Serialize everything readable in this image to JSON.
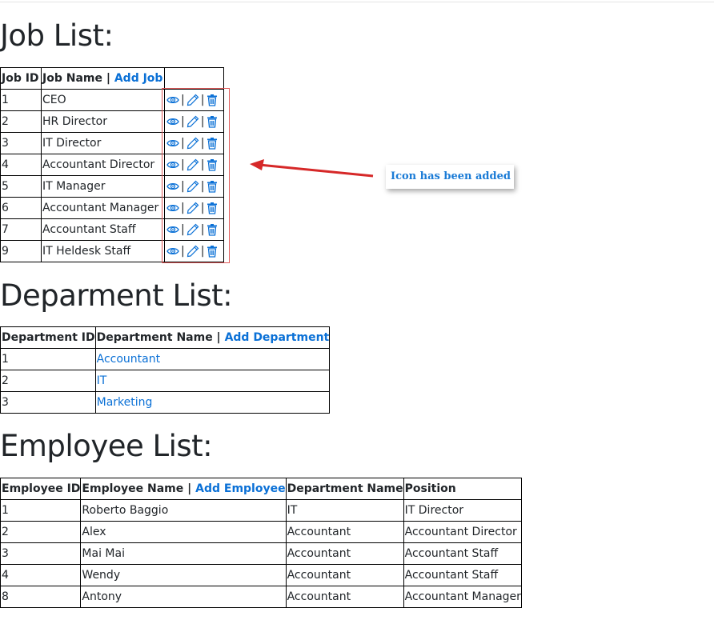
{
  "jobs": {
    "title": "Job List:",
    "headers": {
      "id": "Job ID",
      "name": "Job Name |",
      "add_link": "Add Job"
    },
    "separator": "|",
    "rows": [
      {
        "id": "1",
        "name": "CEO"
      },
      {
        "id": "2",
        "name": "HR Director"
      },
      {
        "id": "3",
        "name": "IT Director"
      },
      {
        "id": "4",
        "name": "Accountant Director"
      },
      {
        "id": "5",
        "name": "IT Manager"
      },
      {
        "id": "6",
        "name": "Accountant Manager"
      },
      {
        "id": "7",
        "name": "Accountant Staff"
      },
      {
        "id": "9",
        "name": "IT Heldesk Staff"
      }
    ]
  },
  "departments": {
    "title": "Deparment List:",
    "headers": {
      "id": "Department ID",
      "name": "Department Name |",
      "add_link": "Add Department"
    },
    "rows": [
      {
        "id": "1",
        "name": "Accountant"
      },
      {
        "id": "2",
        "name": "IT"
      },
      {
        "id": "3",
        "name": "Marketing"
      }
    ]
  },
  "employees": {
    "title": "Employee List:",
    "headers": {
      "id": "Employee ID",
      "name": "Employee Name |",
      "add_link": "Add Employee",
      "department": "Department Name",
      "position": "Position"
    },
    "rows": [
      {
        "id": "1",
        "name": "Roberto Baggio",
        "department": "IT",
        "position": "IT Director"
      },
      {
        "id": "2",
        "name": "Alex",
        "department": "Accountant",
        "position": "Accountant Director"
      },
      {
        "id": "3",
        "name": "Mai Mai",
        "department": "Accountant",
        "position": "Accountant Staff"
      },
      {
        "id": "4",
        "name": "Wendy",
        "department": "Accountant",
        "position": "Accountant Staff"
      },
      {
        "id": "8",
        "name": "Antony",
        "department": "Accountant",
        "position": "Accountant Manager"
      }
    ]
  },
  "annotation": {
    "callout_text": "Icon has been added"
  },
  "colors": {
    "link": "#0a70d6",
    "highlight": "#e05a5a",
    "arrow": "#d62828",
    "callout_text": "#1a7bd6"
  },
  "icons": {
    "view": "eye-icon",
    "edit": "pencil-icon",
    "delete": "trash-icon"
  }
}
